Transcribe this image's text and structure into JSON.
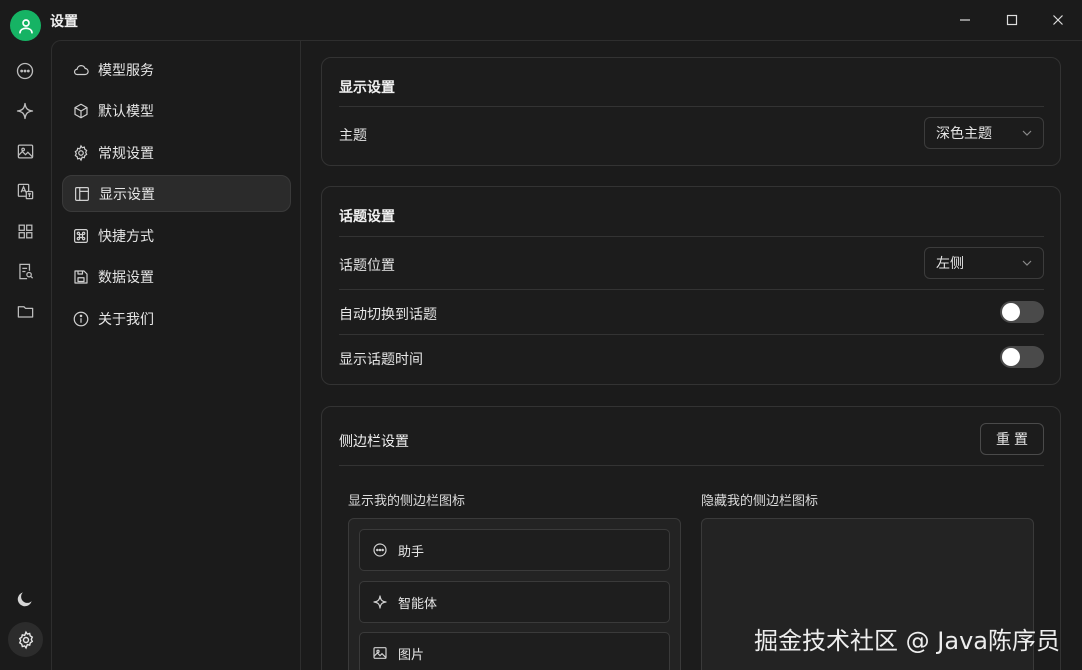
{
  "window": {
    "title": "设置"
  },
  "subnav": {
    "items": [
      {
        "label": "模型服务",
        "icon": "cloud-icon"
      },
      {
        "label": "默认模型",
        "icon": "cube-icon"
      },
      {
        "label": "常规设置",
        "icon": "gear-icon"
      },
      {
        "label": "显示设置",
        "icon": "layout-icon",
        "active": true
      },
      {
        "label": "快捷方式",
        "icon": "command-icon"
      },
      {
        "label": "数据设置",
        "icon": "save-icon"
      },
      {
        "label": "关于我们",
        "icon": "info-icon"
      }
    ]
  },
  "display_section": {
    "title": "显示设置",
    "theme_label": "主题",
    "theme_value": "深色主题"
  },
  "topic_section": {
    "title": "话题设置",
    "position_label": "话题位置",
    "position_value": "左侧",
    "auto_switch_label": "自动切换到话题",
    "auto_switch_on": false,
    "show_time_label": "显示话题时间",
    "show_time_on": false
  },
  "sidebar_section": {
    "title": "侧边栏设置",
    "reset_label": "重置",
    "visible_title": "显示我的侧边栏图标",
    "hidden_title": "隐藏我的侧边栏图标",
    "visible_items": [
      {
        "label": "助手",
        "icon": "chat-bubble-icon"
      },
      {
        "label": "智能体",
        "icon": "sparkle-icon"
      },
      {
        "label": "图片",
        "icon": "image-icon"
      }
    ]
  },
  "watermark": "掘金技术社区 @ Java陈序员",
  "colors": {
    "accent": "#16b364",
    "background": "#1b1b1b",
    "toggle_off": "#4a4a4a"
  }
}
